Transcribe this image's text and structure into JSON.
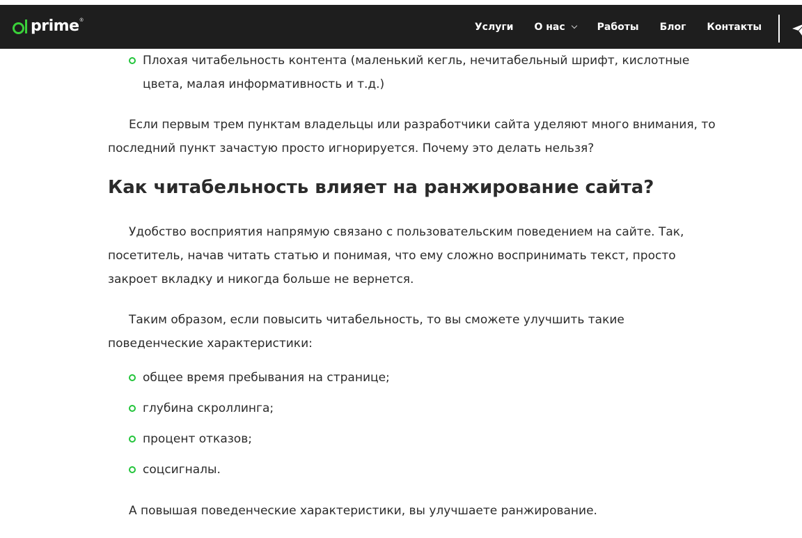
{
  "header": {
    "logo_text": "prime",
    "logo_reg": "®",
    "nav": [
      {
        "label": "Услуги"
      },
      {
        "label": "О нас"
      },
      {
        "label": "Работы"
      },
      {
        "label": "Блог"
      },
      {
        "label": "Контакты"
      }
    ]
  },
  "article": {
    "top_bullet": "Плохая читабельность контента (маленький кегль, нечитабельный шрифт, кислотные цвета, малая информативность и т.д.)",
    "para1": "Если первым трем пунктам владельцы или разработчики сайта уделяют много внимания, то последний пункт зачастую просто игнорируется. Почему это делать нельзя?",
    "heading": "Как читабельность влияет на ранжирование сайта?",
    "para2": "Удобство восприятия напрямую связано с пользовательским поведением на сайте. Так, посетитель, начав читать статью и понимая, что ему сложно воспринимать текст, просто закроет вкладку и никогда больше не вернется.",
    "para3": "Таким образом, если повысить читабельность, то вы сможете улучшить такие поведенческие характеристики:",
    "list": [
      "общее время пребывания на странице;",
      "глубина скроллинга;",
      "процент отказов;",
      "соцсигналы."
    ],
    "para4": "А повышая поведенческие характеристики, вы улучшаете ранжирование."
  },
  "colors": {
    "nav_bg": "#1e1e1e",
    "accent_green": "#22c43a",
    "text": "#2b2b2b"
  }
}
